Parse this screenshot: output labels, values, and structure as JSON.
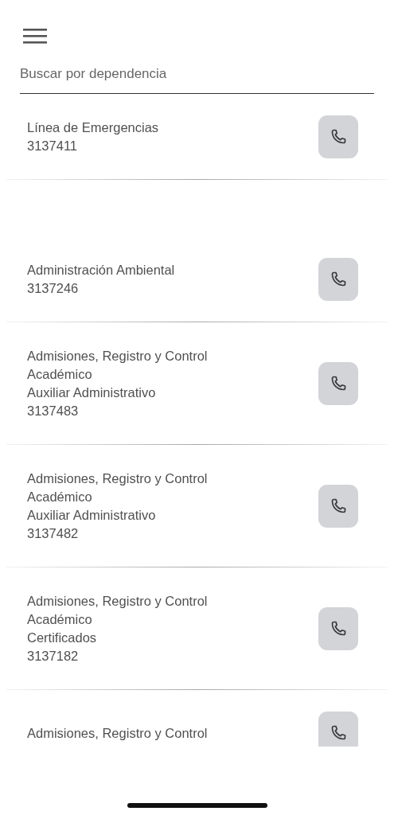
{
  "search": {
    "placeholder": "Buscar por dependencia"
  },
  "pinned": {
    "title": "Línea de Emergencias",
    "phone": "3137411"
  },
  "contacts": [
    {
      "title": "Administración Ambiental",
      "phone": "3137246"
    },
    {
      "title": "Admisiones, Registro y Control Académico",
      "subtitle": "Auxiliar Administrativo",
      "phone": "3137483"
    },
    {
      "title": "Admisiones, Registro y Control Académico",
      "subtitle": "Auxiliar Administrativo",
      "phone": "3137482"
    },
    {
      "title": "Admisiones, Registro y Control Académico",
      "subtitle": "Certificados",
      "phone": "3137182"
    },
    {
      "title": "Admisiones, Registro y Control"
    }
  ]
}
